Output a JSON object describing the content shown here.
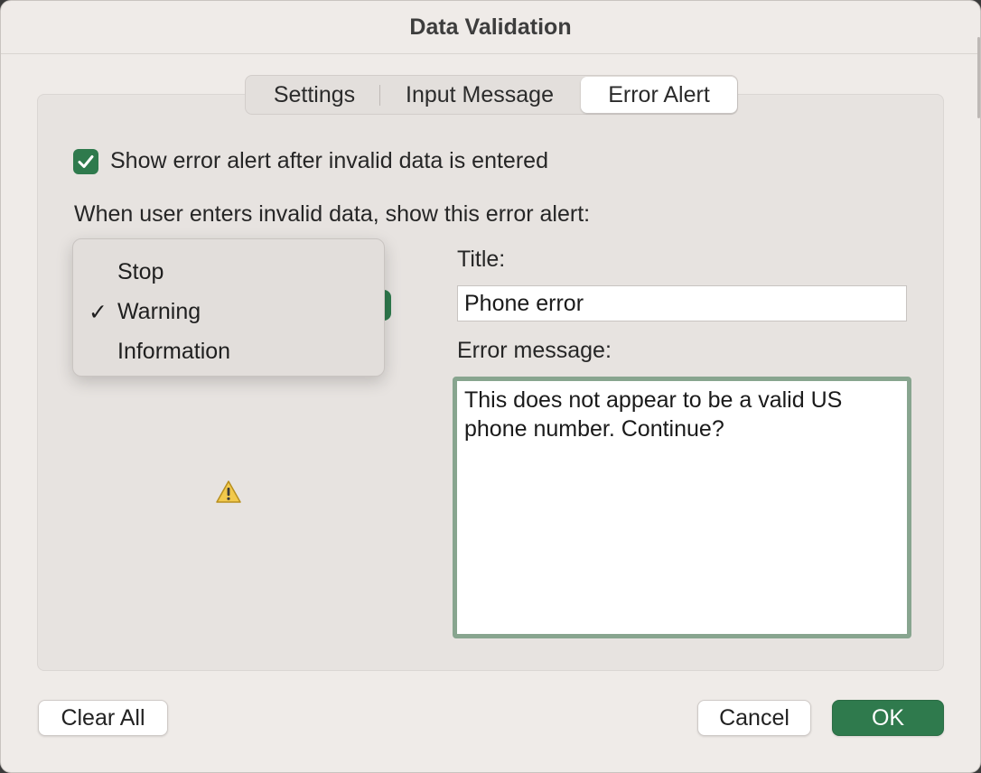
{
  "window": {
    "title": "Data Validation"
  },
  "tabs": [
    {
      "label": "Settings",
      "selected": false
    },
    {
      "label": "Input Message",
      "selected": false
    },
    {
      "label": "Error Alert",
      "selected": true
    }
  ],
  "show_alert": {
    "checked": true,
    "label": "Show error alert after invalid data is entered"
  },
  "instruction": "When user enters invalid data, show this error alert:",
  "style_menu": {
    "items": [
      {
        "label": "Stop",
        "checked": false
      },
      {
        "label": "Warning",
        "checked": true
      },
      {
        "label": "Information",
        "checked": false
      }
    ],
    "check_glyph": "✓",
    "selected_icon": "warning-triangle-icon"
  },
  "title_field": {
    "label": "Title:",
    "value": "Phone error"
  },
  "message_field": {
    "label": "Error message:",
    "value": "This does not appear to be a valid US phone number. Continue?"
  },
  "buttons": {
    "clear_all": "Clear All",
    "cancel": "Cancel",
    "ok": "OK"
  },
  "colors": {
    "accent": "#2f7a4d",
    "focus_ring": "#88a58f",
    "warning": "#f2c94c"
  }
}
